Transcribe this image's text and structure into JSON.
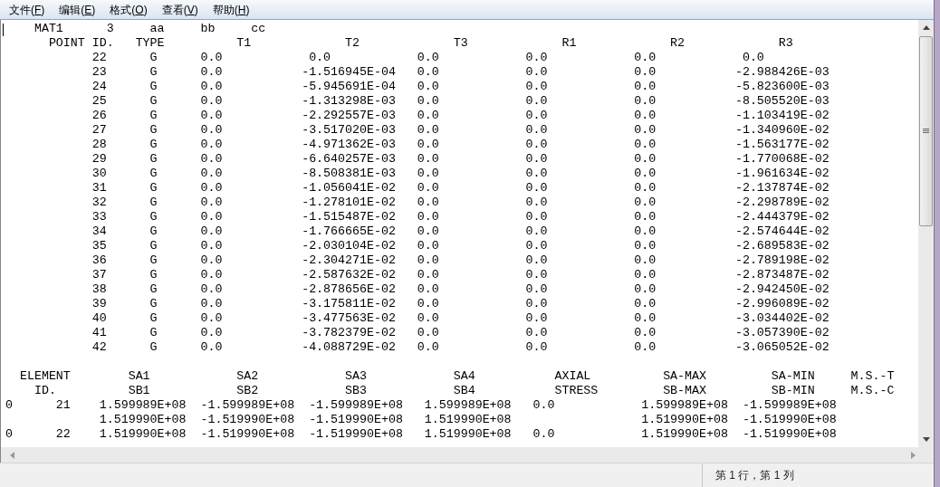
{
  "menu": [
    {
      "before": "文件(",
      "key": "F",
      "after": ")"
    },
    {
      "before": "编辑(",
      "key": "E",
      "after": ")"
    },
    {
      "before": "格式(",
      "key": "O",
      "after": ")"
    },
    {
      "before": "查看(",
      "key": "V",
      "after": ")"
    },
    {
      "before": "帮助(",
      "key": "H",
      "after": ")"
    }
  ],
  "text_lines": [
    "    MAT1      3     aa     bb     cc",
    "      POINT ID.   TYPE          T1             T2             T3             R1             R2             R3",
    "            22      G      0.0            0.0            0.0            0.0            0.0            0.0",
    "            23      G      0.0           -1.516945E-04   0.0            0.0            0.0           -2.988426E-03",
    "            24      G      0.0           -5.945691E-04   0.0            0.0            0.0           -5.823600E-03",
    "            25      G      0.0           -1.313298E-03   0.0            0.0            0.0           -8.505520E-03",
    "            26      G      0.0           -2.292557E-03   0.0            0.0            0.0           -1.103419E-02",
    "            27      G      0.0           -3.517020E-03   0.0            0.0            0.0           -1.340960E-02",
    "            28      G      0.0           -4.971362E-03   0.0            0.0            0.0           -1.563177E-02",
    "            29      G      0.0           -6.640257E-03   0.0            0.0            0.0           -1.770068E-02",
    "            30      G      0.0           -8.508381E-03   0.0            0.0            0.0           -1.961634E-02",
    "            31      G      0.0           -1.056041E-02   0.0            0.0            0.0           -2.137874E-02",
    "            32      G      0.0           -1.278101E-02   0.0            0.0            0.0           -2.298789E-02",
    "            33      G      0.0           -1.515487E-02   0.0            0.0            0.0           -2.444379E-02",
    "            34      G      0.0           -1.766665E-02   0.0            0.0            0.0           -2.574644E-02",
    "            35      G      0.0           -2.030104E-02   0.0            0.0            0.0           -2.689583E-02",
    "            36      G      0.0           -2.304271E-02   0.0            0.0            0.0           -2.789198E-02",
    "            37      G      0.0           -2.587632E-02   0.0            0.0            0.0           -2.873487E-02",
    "            38      G      0.0           -2.878656E-02   0.0            0.0            0.0           -2.942450E-02",
    "            39      G      0.0           -3.175811E-02   0.0            0.0            0.0           -2.996089E-02",
    "            40      G      0.0           -3.477563E-02   0.0            0.0            0.0           -3.034402E-02",
    "            41      G      0.0           -3.782379E-02   0.0            0.0            0.0           -3.057390E-02",
    "            42      G      0.0           -4.088729E-02   0.0            0.0            0.0           -3.065052E-02"
  ],
  "element_lines": [
    "  ELEMENT        SA1            SA2            SA3            SA4           AXIAL          SA-MAX         SA-MIN     M.S.-T",
    "    ID.          SB1            SB2            SB3            SB4           STRESS         SB-MAX         SB-MIN     M.S.-C",
    "0      21    1.599989E+08  -1.599989E+08  -1.599989E+08   1.599989E+08   0.0            1.599989E+08  -1.599989E+08",
    "             1.519990E+08  -1.519990E+08  -1.519990E+08   1.519990E+08                  1.519990E+08  -1.519990E+08",
    "0      22    1.519990E+08  -1.519990E+08  -1.519990E+08   1.519990E+08   0.0            1.519990E+08  -1.519990E+08"
  ],
  "status_bar": {
    "position": "第 1 行，第 1 列"
  }
}
